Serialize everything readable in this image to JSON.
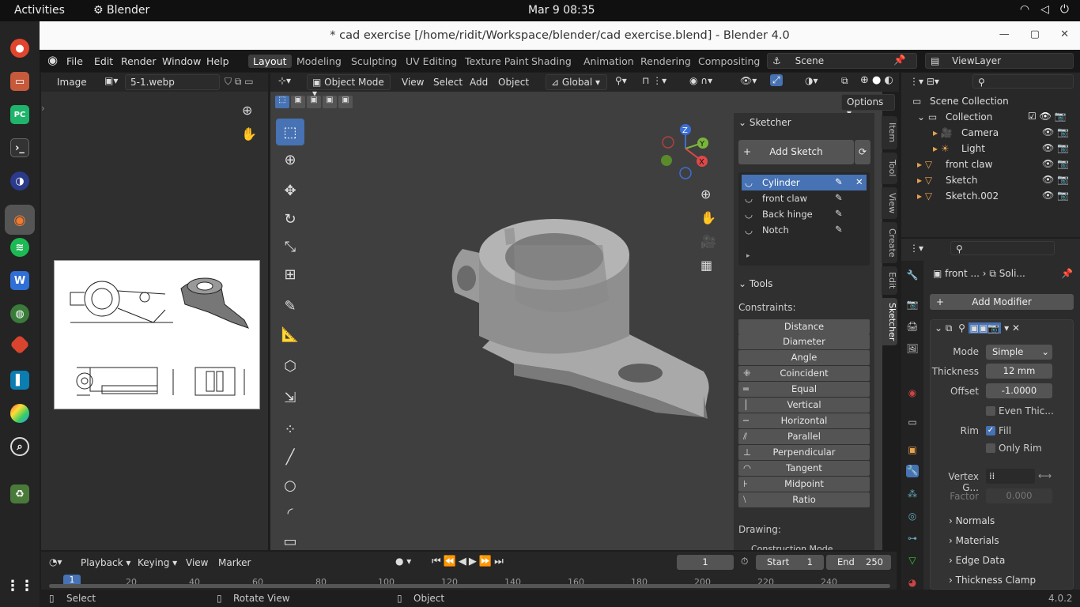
{
  "topbar": {
    "activities": "Activities",
    "app": "Blender",
    "clock": "Mar 9  08:35"
  },
  "window": {
    "title": "* cad exercise [/home/ridit/Workspace/blender/cad exercise.blend] - Blender 4.0"
  },
  "menu": {
    "items": [
      "File",
      "Edit",
      "Render",
      "Window",
      "Help"
    ]
  },
  "workspaces": [
    "Layout",
    "Modeling",
    "Sculpting",
    "UV Editing",
    "Texture Paint",
    "Shading",
    "Animation",
    "Rendering",
    "Compositing"
  ],
  "scene": {
    "name": "Scene",
    "viewlayer": "ViewLayer"
  },
  "image_editor": {
    "label": "Image",
    "filename": "5-1.webp"
  },
  "viewport": {
    "mode": "Object Mode",
    "menus": [
      "View",
      "Select",
      "Add",
      "Object"
    ],
    "orientation": "Global",
    "options": "Options"
  },
  "sketcher": {
    "header": "Sketcher",
    "add_sketch": "Add Sketch",
    "sketches": [
      "Cylinder",
      "front claw",
      "Back hinge",
      "Notch"
    ],
    "tools_header": "Tools",
    "constraints_label": "Constraints:",
    "constraints": [
      "Distance",
      "Diameter",
      "Angle",
      "Coincident",
      "Equal",
      "Vertical",
      "Horizontal",
      "Parallel",
      "Perpendicular",
      "Tangent",
      "Midpoint",
      "Ratio"
    ],
    "drawing_label": "Drawing:",
    "construction": "Construction Mode"
  },
  "ntabs": [
    "Item",
    "Tool",
    "View",
    "Create",
    "Edit",
    "Sketcher"
  ],
  "outliner": {
    "root": "Scene Collection",
    "items": [
      "Collection",
      "Camera",
      "Light",
      "front claw",
      "Sketch",
      "Sketch.002"
    ]
  },
  "properties": {
    "breadcrumb_obj": "front ...",
    "breadcrumb_mod": "Soli...",
    "add_modifier": "Add Modifier",
    "mode_label": "Mode",
    "mode": "Simple",
    "thickness_label": "Thickness",
    "thickness": "12 mm",
    "offset_label": "Offset",
    "offset": "-1.0000",
    "even_thickness": "Even Thic...",
    "rim_label": "Rim",
    "fill": "Fill",
    "only_rim": "Only Rim",
    "vertex_group_label": "Vertex G...",
    "factor_label": "Factor",
    "factor": "0.000",
    "sections": [
      "Normals",
      "Materials",
      "Edge Data",
      "Thickness Clamp"
    ]
  },
  "timeline": {
    "menus": [
      "Playback",
      "Keying",
      "View",
      "Marker"
    ],
    "current_frame": "1",
    "start_label": "Start",
    "start": "1",
    "end_label": "End",
    "end": "250",
    "ticks": [
      "20",
      "40",
      "60",
      "80",
      "100",
      "120",
      "140",
      "160",
      "180",
      "200",
      "220",
      "240"
    ],
    "playhead": "1"
  },
  "status": {
    "select": "Select",
    "rotate": "Rotate View",
    "object": "Object",
    "version": "4.0.2"
  },
  "colors": {
    "accent": "#4772b3",
    "viewport_bg": "#3f3f3f"
  }
}
